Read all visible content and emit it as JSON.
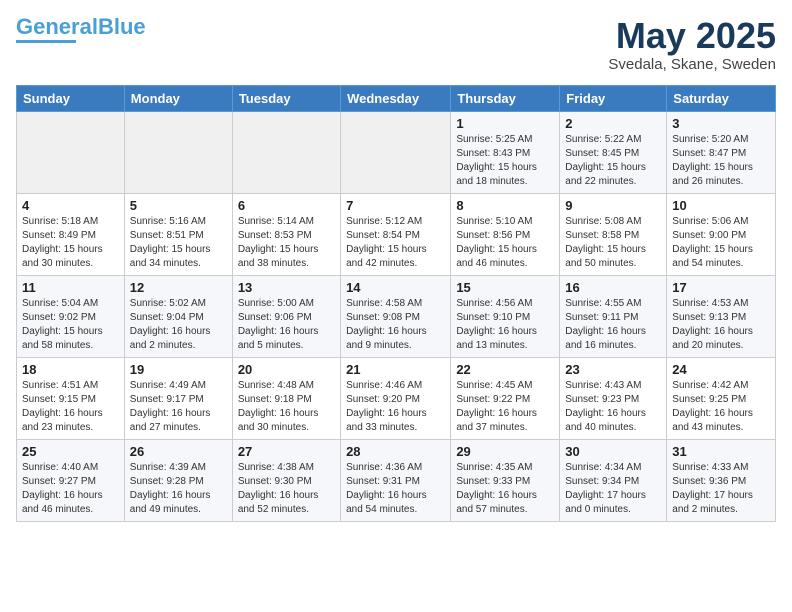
{
  "logo": {
    "part1": "General",
    "part2": "Blue"
  },
  "title": "May 2025",
  "subtitle": "Svedala, Skane, Sweden",
  "days_header": [
    "Sunday",
    "Monday",
    "Tuesday",
    "Wednesday",
    "Thursday",
    "Friday",
    "Saturday"
  ],
  "weeks": [
    [
      {
        "day": "",
        "info": ""
      },
      {
        "day": "",
        "info": ""
      },
      {
        "day": "",
        "info": ""
      },
      {
        "day": "",
        "info": ""
      },
      {
        "day": "1",
        "info": "Sunrise: 5:25 AM\nSunset: 8:43 PM\nDaylight: 15 hours\nand 18 minutes."
      },
      {
        "day": "2",
        "info": "Sunrise: 5:22 AM\nSunset: 8:45 PM\nDaylight: 15 hours\nand 22 minutes."
      },
      {
        "day": "3",
        "info": "Sunrise: 5:20 AM\nSunset: 8:47 PM\nDaylight: 15 hours\nand 26 minutes."
      }
    ],
    [
      {
        "day": "4",
        "info": "Sunrise: 5:18 AM\nSunset: 8:49 PM\nDaylight: 15 hours\nand 30 minutes."
      },
      {
        "day": "5",
        "info": "Sunrise: 5:16 AM\nSunset: 8:51 PM\nDaylight: 15 hours\nand 34 minutes."
      },
      {
        "day": "6",
        "info": "Sunrise: 5:14 AM\nSunset: 8:53 PM\nDaylight: 15 hours\nand 38 minutes."
      },
      {
        "day": "7",
        "info": "Sunrise: 5:12 AM\nSunset: 8:54 PM\nDaylight: 15 hours\nand 42 minutes."
      },
      {
        "day": "8",
        "info": "Sunrise: 5:10 AM\nSunset: 8:56 PM\nDaylight: 15 hours\nand 46 minutes."
      },
      {
        "day": "9",
        "info": "Sunrise: 5:08 AM\nSunset: 8:58 PM\nDaylight: 15 hours\nand 50 minutes."
      },
      {
        "day": "10",
        "info": "Sunrise: 5:06 AM\nSunset: 9:00 PM\nDaylight: 15 hours\nand 54 minutes."
      }
    ],
    [
      {
        "day": "11",
        "info": "Sunrise: 5:04 AM\nSunset: 9:02 PM\nDaylight: 15 hours\nand 58 minutes."
      },
      {
        "day": "12",
        "info": "Sunrise: 5:02 AM\nSunset: 9:04 PM\nDaylight: 16 hours\nand 2 minutes."
      },
      {
        "day": "13",
        "info": "Sunrise: 5:00 AM\nSunset: 9:06 PM\nDaylight: 16 hours\nand 5 minutes."
      },
      {
        "day": "14",
        "info": "Sunrise: 4:58 AM\nSunset: 9:08 PM\nDaylight: 16 hours\nand 9 minutes."
      },
      {
        "day": "15",
        "info": "Sunrise: 4:56 AM\nSunset: 9:10 PM\nDaylight: 16 hours\nand 13 minutes."
      },
      {
        "day": "16",
        "info": "Sunrise: 4:55 AM\nSunset: 9:11 PM\nDaylight: 16 hours\nand 16 minutes."
      },
      {
        "day": "17",
        "info": "Sunrise: 4:53 AM\nSunset: 9:13 PM\nDaylight: 16 hours\nand 20 minutes."
      }
    ],
    [
      {
        "day": "18",
        "info": "Sunrise: 4:51 AM\nSunset: 9:15 PM\nDaylight: 16 hours\nand 23 minutes."
      },
      {
        "day": "19",
        "info": "Sunrise: 4:49 AM\nSunset: 9:17 PM\nDaylight: 16 hours\nand 27 minutes."
      },
      {
        "day": "20",
        "info": "Sunrise: 4:48 AM\nSunset: 9:18 PM\nDaylight: 16 hours\nand 30 minutes."
      },
      {
        "day": "21",
        "info": "Sunrise: 4:46 AM\nSunset: 9:20 PM\nDaylight: 16 hours\nand 33 minutes."
      },
      {
        "day": "22",
        "info": "Sunrise: 4:45 AM\nSunset: 9:22 PM\nDaylight: 16 hours\nand 37 minutes."
      },
      {
        "day": "23",
        "info": "Sunrise: 4:43 AM\nSunset: 9:23 PM\nDaylight: 16 hours\nand 40 minutes."
      },
      {
        "day": "24",
        "info": "Sunrise: 4:42 AM\nSunset: 9:25 PM\nDaylight: 16 hours\nand 43 minutes."
      }
    ],
    [
      {
        "day": "25",
        "info": "Sunrise: 4:40 AM\nSunset: 9:27 PM\nDaylight: 16 hours\nand 46 minutes."
      },
      {
        "day": "26",
        "info": "Sunrise: 4:39 AM\nSunset: 9:28 PM\nDaylight: 16 hours\nand 49 minutes."
      },
      {
        "day": "27",
        "info": "Sunrise: 4:38 AM\nSunset: 9:30 PM\nDaylight: 16 hours\nand 52 minutes."
      },
      {
        "day": "28",
        "info": "Sunrise: 4:36 AM\nSunset: 9:31 PM\nDaylight: 16 hours\nand 54 minutes."
      },
      {
        "day": "29",
        "info": "Sunrise: 4:35 AM\nSunset: 9:33 PM\nDaylight: 16 hours\nand 57 minutes."
      },
      {
        "day": "30",
        "info": "Sunrise: 4:34 AM\nSunset: 9:34 PM\nDaylight: 17 hours\nand 0 minutes."
      },
      {
        "day": "31",
        "info": "Sunrise: 4:33 AM\nSunset: 9:36 PM\nDaylight: 17 hours\nand 2 minutes."
      }
    ]
  ]
}
